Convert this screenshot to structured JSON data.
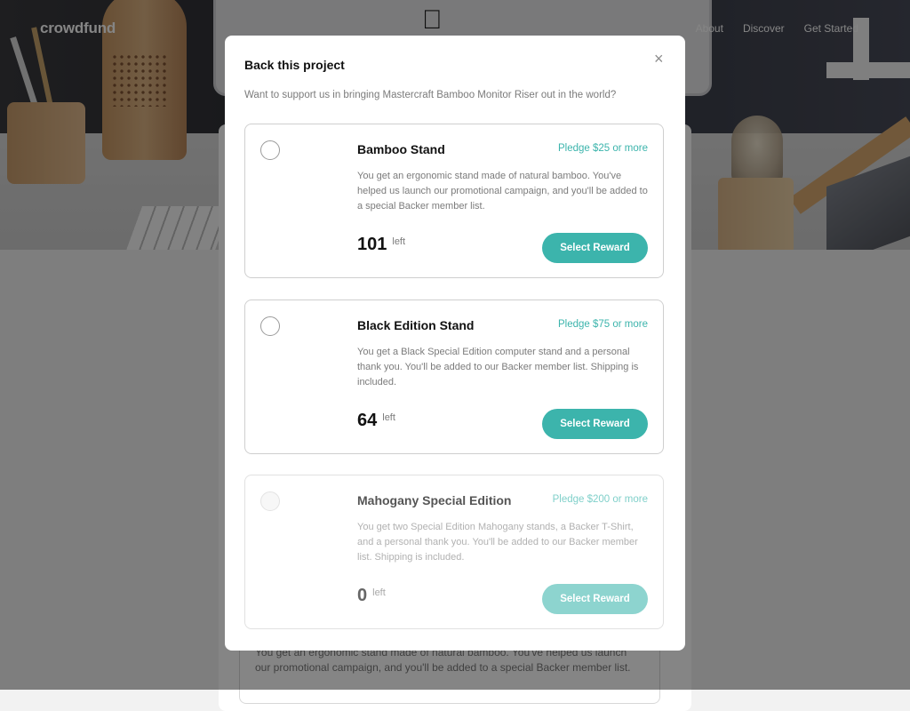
{
  "nav": {
    "logo": "crowdfund",
    "links": [
      "About",
      "Discover",
      "Get Started"
    ]
  },
  "background": {
    "partial_reward_text": "You get an ergonomic stand made of natural bamboo. You've helped us launch our promotional campaign, and you'll be added to a special Backer member list."
  },
  "modal": {
    "title": "Back this project",
    "close_glyph": "×",
    "subtitle": "Want to support us in bringing Mastercraft Bamboo Monitor Riser out in the world?",
    "rewards": [
      {
        "name": "Bamboo Stand",
        "pledge": "Pledge $25 or more",
        "description": "You get an ergonomic stand made of natural bamboo. You've helped us launch our promotional campaign, and you'll be added to a special Backer member list.",
        "count": "101",
        "left_label": "left",
        "button": "Select Reward",
        "available": true
      },
      {
        "name": "Black Edition Stand",
        "pledge": "Pledge $75 or more",
        "description": "You get a Black Special Edition computer stand and a personal thank you. You'll be added to our Backer member list. Shipping is included.",
        "count": "64",
        "left_label": "left",
        "button": "Select Reward",
        "available": true
      },
      {
        "name": "Mahogany Special Edition",
        "pledge": "Pledge $200 or more",
        "description": "You get two Special Edition Mahogany stands, a Backer T-Shirt, and a personal thank you. You'll be added to our Backer member list. Shipping is included.",
        "count": "0",
        "left_label": "left",
        "button": "Select Reward",
        "available": false
      }
    ]
  },
  "colors": {
    "accent": "#3cb4ac",
    "accent_disabled": "#8dd4cf",
    "overlay": "rgba(0,0,0,0.48)"
  }
}
